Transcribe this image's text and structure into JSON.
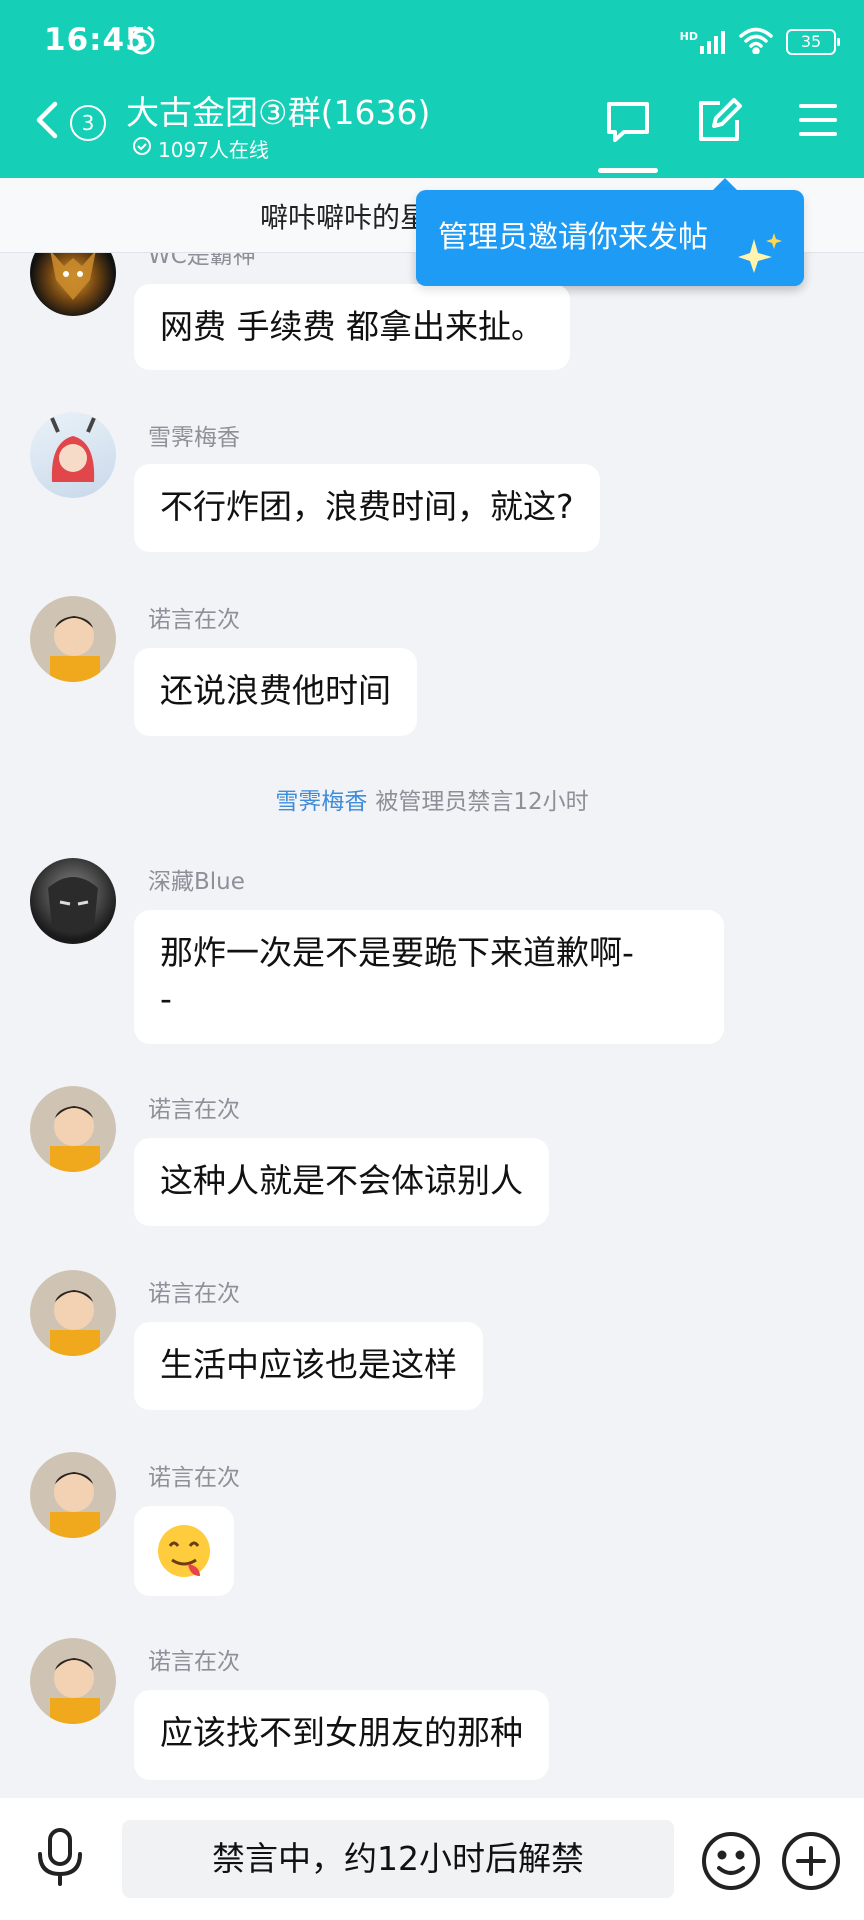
{
  "status_bar": {
    "time": "16:45",
    "network": "HD",
    "battery": "35"
  },
  "header": {
    "unread_count": "3",
    "title": "大古金团③群(1636)",
    "online_text": "1097人在线"
  },
  "notice": {
    "text": "噼咔噼咔的星",
    "tooltip": "管理员邀请你来发帖"
  },
  "messages": [
    {
      "sender": "WC是霸神",
      "text": "网费 手续费 都拿出来扯。"
    },
    {
      "sender": "雪霁梅香",
      "text": "不行炸团，浪费时间，就这?"
    },
    {
      "sender": "诺言在次",
      "text": "还说浪费他时间"
    },
    {
      "sender": "深藏Blue",
      "text_line1": "那炸一次是不是要跪下来道歉啊-",
      "text_line2": "-"
    },
    {
      "sender": "诺言在次",
      "text": "这种人就是不会体谅别人"
    },
    {
      "sender": "诺言在次",
      "text": "生活中应该也是这样"
    },
    {
      "sender": "诺言在次",
      "emoji": "😋"
    },
    {
      "sender": "诺言在次",
      "text": "应该找不到女朋友的那种"
    }
  ],
  "system_notice": {
    "name": "雪霁梅香",
    "text": "被管理员禁言12小时"
  },
  "input_bar": {
    "muted_text": "禁言中，约12小时后解禁"
  },
  "colors": {
    "header": "#15cfb6",
    "tooltip": "#1d9bf5",
    "link": "#3f8cd8"
  }
}
